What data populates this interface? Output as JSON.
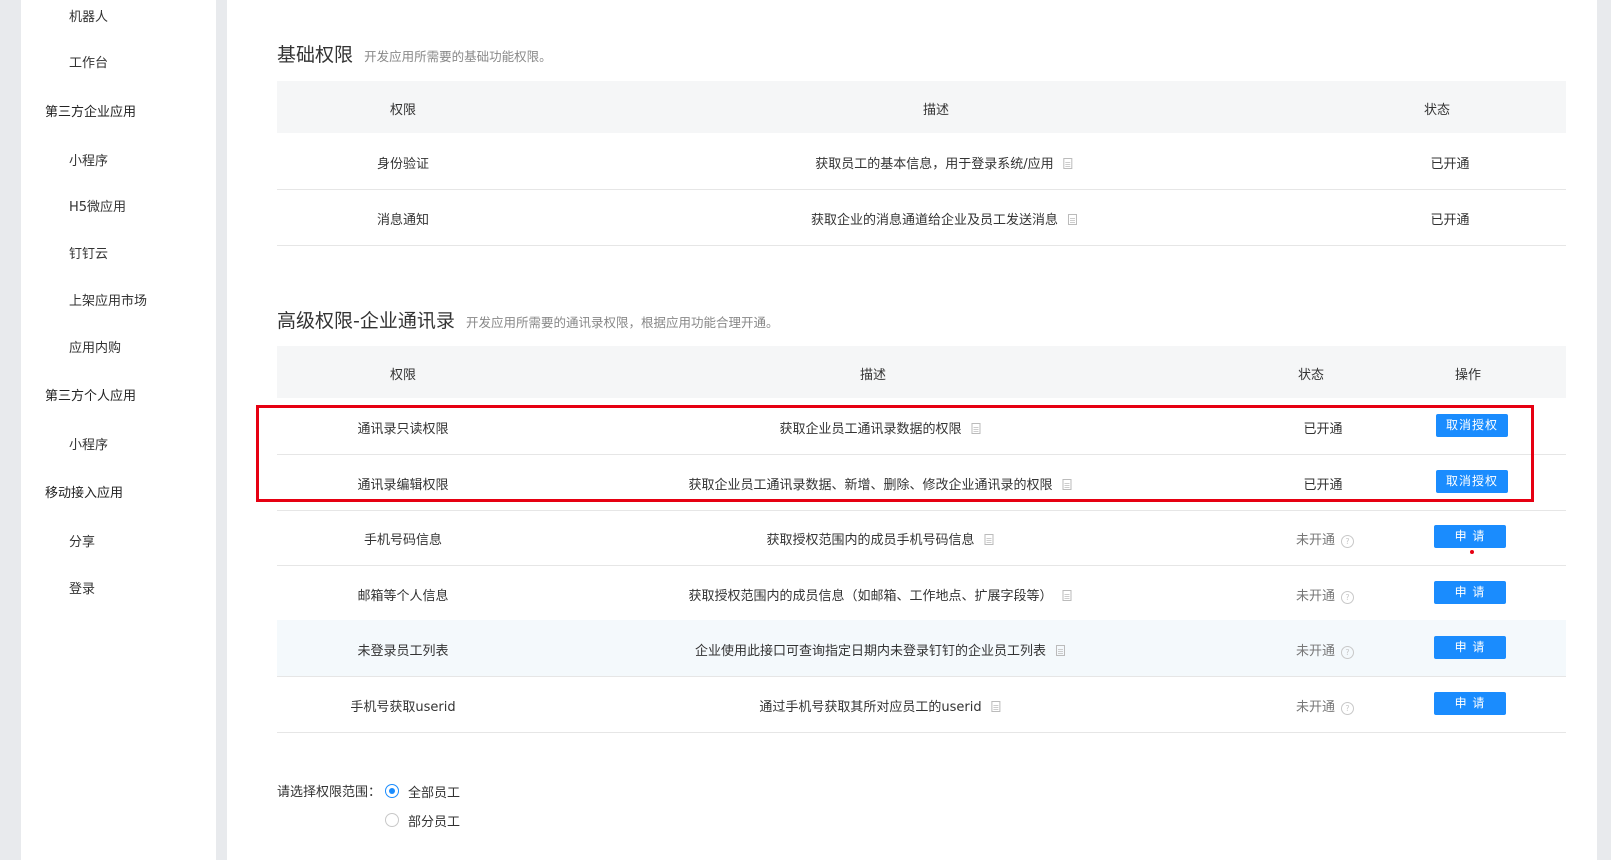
{
  "sidebar": {
    "items": [
      {
        "label": "机器人",
        "kind": "sub"
      },
      {
        "label": "工作台",
        "kind": "sub"
      },
      {
        "label": "第三方企业应用",
        "kind": "group"
      },
      {
        "label": "小程序",
        "kind": "sub"
      },
      {
        "label": "H5微应用",
        "kind": "sub"
      },
      {
        "label": "钉钉云",
        "kind": "sub"
      },
      {
        "label": "上架应用市场",
        "kind": "sub"
      },
      {
        "label": "应用内购",
        "kind": "sub"
      },
      {
        "label": "第三方个人应用",
        "kind": "group"
      },
      {
        "label": "小程序",
        "kind": "sub"
      },
      {
        "label": "移动接入应用",
        "kind": "group"
      },
      {
        "label": "分享",
        "kind": "sub"
      },
      {
        "label": "登录",
        "kind": "sub"
      }
    ]
  },
  "basic": {
    "title": "基础权限",
    "desc": "开发应用所需要的基础功能权限。",
    "headers": {
      "perm": "权限",
      "desc": "描述",
      "status": "状态"
    },
    "rows": [
      {
        "perm": "身份验证",
        "desc": "获取员工的基本信息，用于登录系统/应用",
        "status": "已开通"
      },
      {
        "perm": "消息通知",
        "desc": "获取企业的消息通道给企业及员工发送消息",
        "status": "已开通"
      }
    ]
  },
  "advanced": {
    "title": "高级权限-企业通讯录",
    "desc": "开发应用所需要的通讯录权限，根据应用功能合理开通。",
    "headers": {
      "perm": "权限",
      "desc": "描述",
      "status": "状态",
      "action": "操作"
    },
    "rows": [
      {
        "perm": "通讯录只读权限",
        "desc": "获取企业员工通讯录数据的权限",
        "status": "已开通",
        "action": "取消授权"
      },
      {
        "perm": "通讯录编辑权限",
        "desc": "获取企业员工通讯录数据、新增、删除、修改企业通讯录的权限",
        "status": "已开通",
        "action": "取消授权"
      },
      {
        "perm": "手机号码信息",
        "desc": "获取授权范围内的成员手机号码信息",
        "status": "未开通",
        "action": "申 请"
      },
      {
        "perm": "邮箱等个人信息",
        "desc": "获取授权范围内的成员信息（如邮箱、工作地点、扩展字段等）",
        "status": "未开通",
        "action": "申 请"
      },
      {
        "perm": "未登录员工列表",
        "desc": "企业使用此接口可查询指定日期内未登录钉钉的企业员工列表",
        "status": "未开通",
        "action": "申 请"
      },
      {
        "perm": "手机号获取userid",
        "desc": "通过手机号获取其所对应员工的userid",
        "status": "未开通",
        "action": "申 请"
      }
    ]
  },
  "scope": {
    "label": "请选择权限范围：",
    "options": [
      "全部员工",
      "部分员工"
    ],
    "selected": "全部员工"
  },
  "colors": {
    "accent": "#1a8cfe",
    "highlight_box": "#e60012",
    "sidebar_bg": "#ffffff",
    "page_bg": "#e8eaed"
  }
}
